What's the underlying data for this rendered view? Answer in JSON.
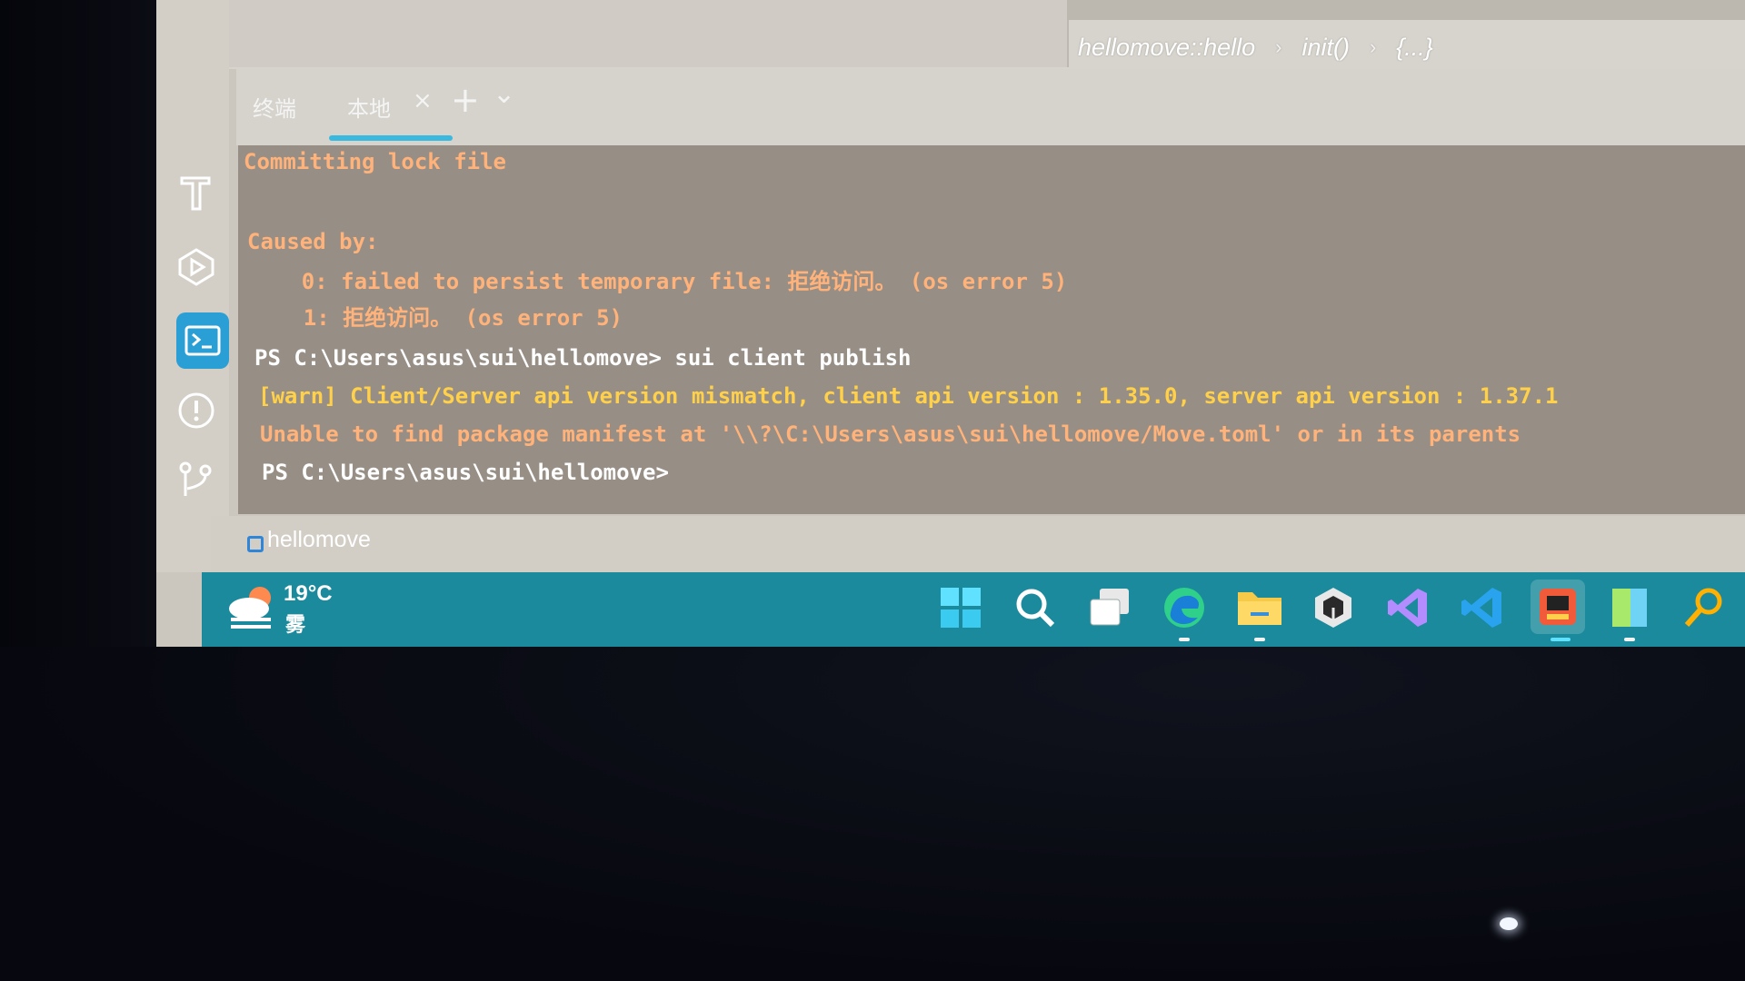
{
  "breadcrumb": {
    "module": "hellomove::hello",
    "function": "init()",
    "block": "{...}"
  },
  "panel": {
    "tabs": [
      {
        "label": "终端",
        "active": false
      },
      {
        "label": "本地",
        "active": true
      }
    ],
    "close_glyph": "×",
    "add_glyph": "+",
    "dropdown_glyph": "⌄"
  },
  "terminal": {
    "lines": [
      {
        "text": "Committing lock file",
        "color": "orange"
      },
      {
        "text": "",
        "color": "white"
      },
      {
        "text": "Caused by:",
        "color": "orange"
      },
      {
        "text": "    0: failed to persist temporary file: 拒绝访问。 (os error 5)",
        "color": "orange"
      },
      {
        "text": "    1: 拒绝访问。 (os error 5)",
        "color": "orange"
      },
      {
        "text": "PS C:\\Users\\asus\\sui\\hellomove> sui client publish",
        "color": "white"
      },
      {
        "text": "[warn] Client/Server api version mismatch, client api version : 1.35.0, server api version : 1.37.1",
        "color": "yellow"
      },
      {
        "text": "Unable to find package manifest at '\\\\?\\C:\\Users\\asus\\sui\\hellomove/Move.toml' or in its parents",
        "color": "orange"
      },
      {
        "text": "PS C:\\Users\\asus\\sui\\hellomove>",
        "color": "white"
      }
    ]
  },
  "status_bar": {
    "project": "hellomove"
  },
  "activity_bar": {
    "icons": [
      "hammer-icon",
      "play-circle-icon",
      "terminal-icon",
      "alert-icon",
      "git-branch-icon"
    ],
    "active": "terminal-icon"
  },
  "taskbar": {
    "weather": {
      "temperature": "19°C",
      "condition": "雾"
    },
    "icons": [
      "windows-start-icon",
      "search-icon",
      "task-view-icon",
      "edge-icon",
      "file-explorer-icon",
      "unity-icon",
      "visual-studio-icon",
      "vscode-icon",
      "app-icon",
      "notepad-icon",
      "search-magnifier-icon"
    ]
  },
  "colors": {
    "terminal_bg": "#978e85",
    "orange": "#ffb27a",
    "yellow": "#ffd04a",
    "accent": "#39b9e0",
    "taskbar": "#1b8a9c"
  }
}
